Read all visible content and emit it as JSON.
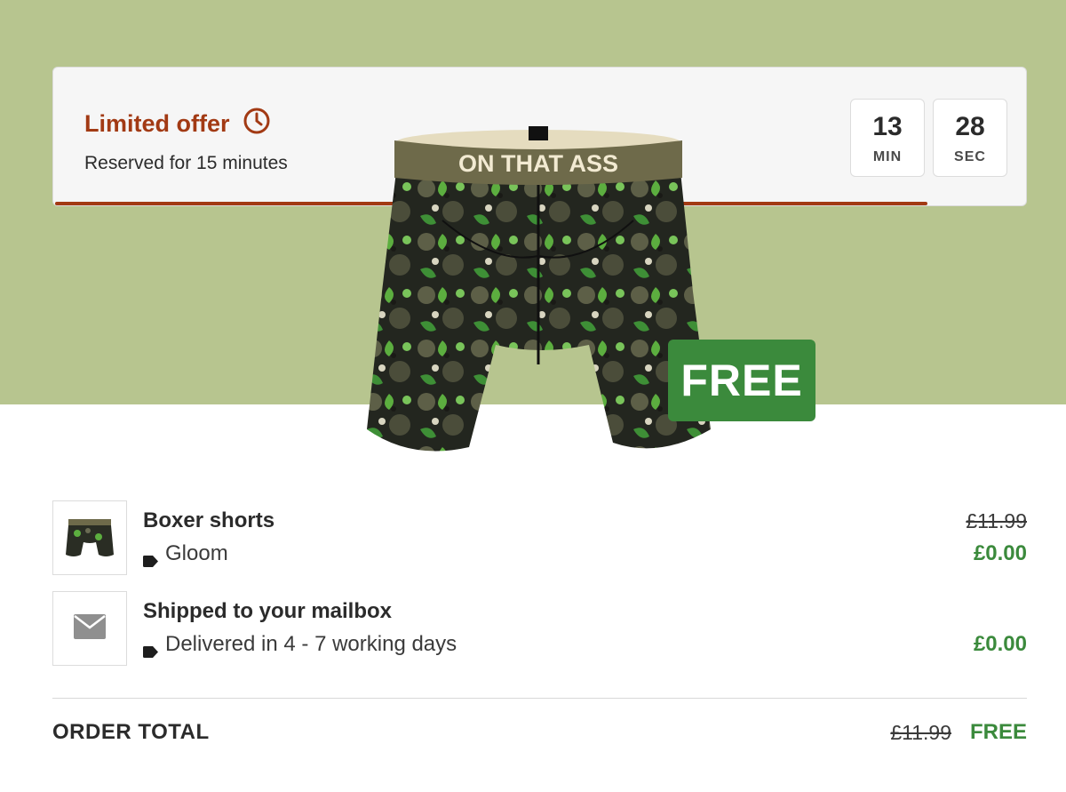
{
  "colors": {
    "hero_bg": "#b7c58f",
    "accent": "#a23a14",
    "free_green": "#3b8a3c"
  },
  "offer": {
    "title": "Limited offer",
    "subtitle": "Reserved for 15 minutes",
    "progress": 0.9,
    "timer": {
      "minutes": "13",
      "min_label": "MIN",
      "seconds": "28",
      "sec_label": "SEC"
    }
  },
  "product": {
    "waistband_text": "ON THAT ASS",
    "badge": "FREE"
  },
  "line_items": [
    {
      "title": "Boxer shorts",
      "detail": "Gloom",
      "old_price": "£11.99",
      "price": "£0.00",
      "icon": "boxer-thumbnail"
    },
    {
      "title": "Shipped to your mailbox",
      "detail": "Delivered in 4 - 7 working days",
      "price": "£0.00",
      "icon": "envelope-icon"
    }
  ],
  "total": {
    "label": "ORDER TOTAL",
    "old_price": "£11.99",
    "price": "FREE"
  }
}
